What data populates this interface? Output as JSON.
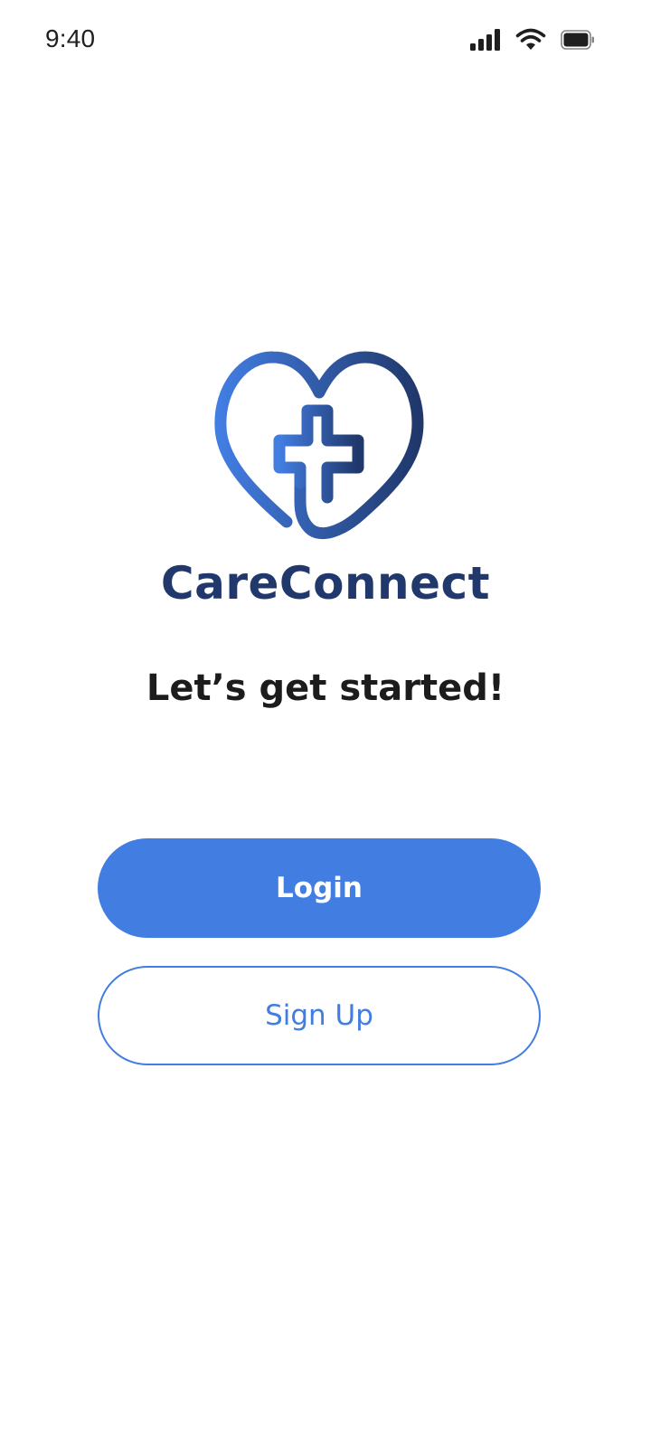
{
  "status_bar": {
    "time": "9:40",
    "icons": [
      "cellular-signal-icon",
      "wifi-icon",
      "battery-icon"
    ]
  },
  "brand": {
    "logo_icon": "heart-cross-icon",
    "name": "CareConnect",
    "name_color": "#20386b",
    "logo_gradient": [
      "#427de2",
      "#20386b"
    ]
  },
  "headline": "Let’s get started!",
  "actions": {
    "login_label": "Login",
    "signup_label": "Sign Up",
    "accent_color": "#427de2"
  }
}
